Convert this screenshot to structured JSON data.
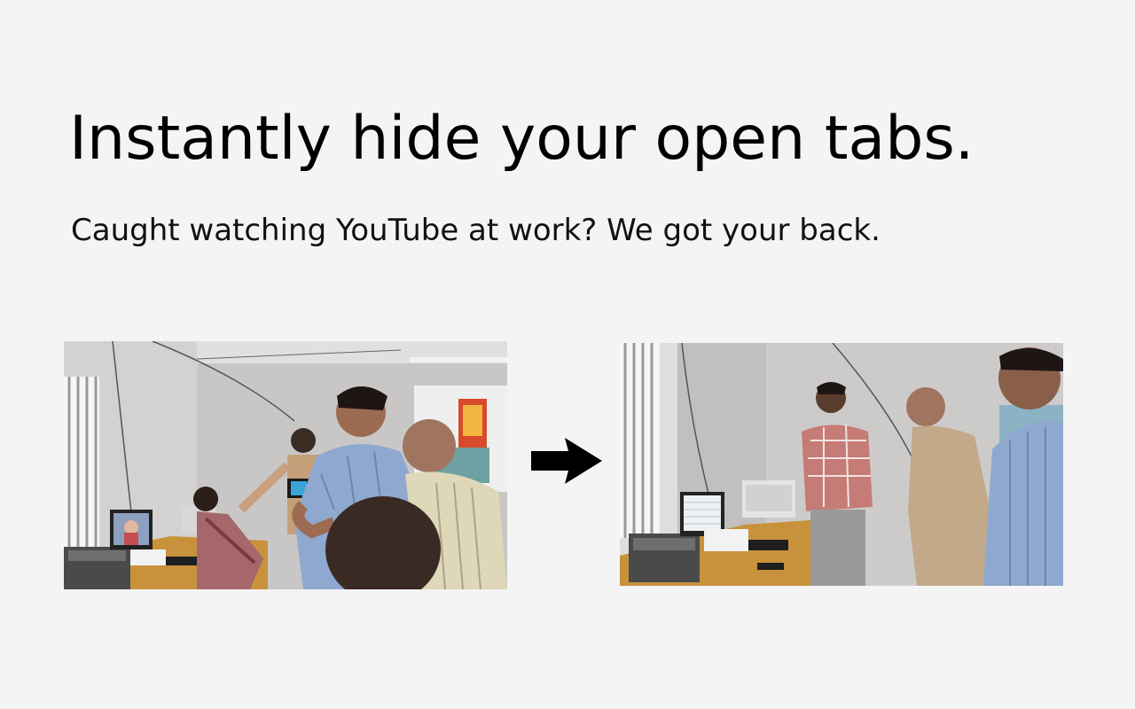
{
  "hero": {
    "headline": "Instantly hide your open tabs.",
    "subheadline": "Caught watching YouTube at work? We got your back."
  },
  "illustration": {
    "arrow_icon": "right-arrow-icon",
    "colors": {
      "background": "#f4f4f4",
      "arrow": "#000000"
    }
  }
}
